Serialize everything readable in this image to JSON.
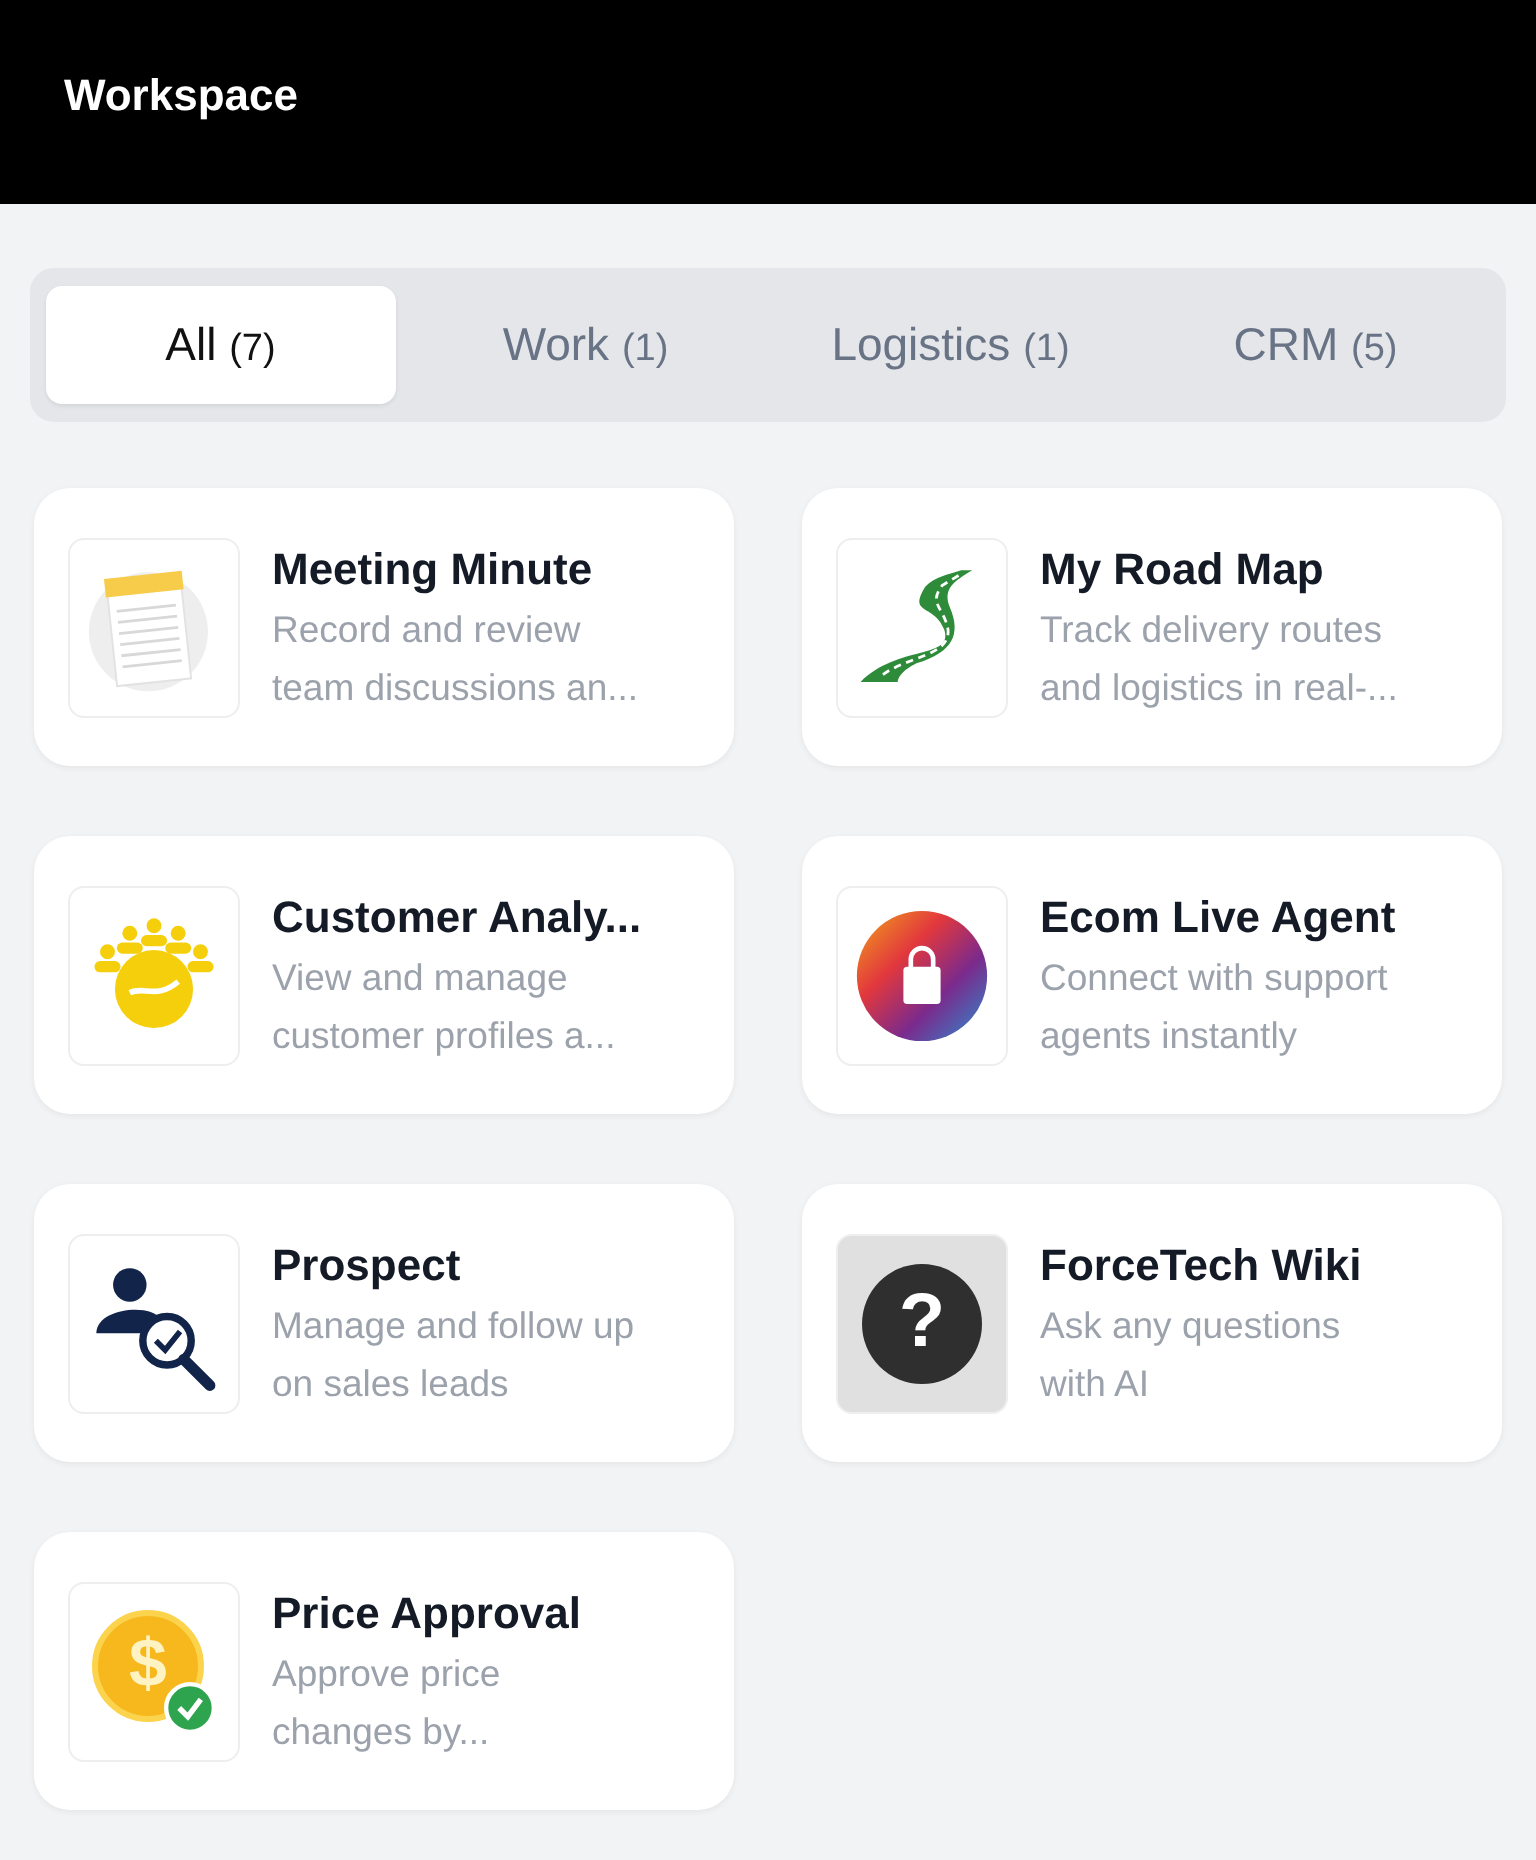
{
  "header": {
    "title": "Workspace"
  },
  "tabs": [
    {
      "label": "All",
      "count": "(7)",
      "selected": true
    },
    {
      "label": "Work",
      "count": "(1)",
      "selected": false
    },
    {
      "label": "Logistics",
      "count": "(1)",
      "selected": false
    },
    {
      "label": "CRM",
      "count": "(5)",
      "selected": false
    }
  ],
  "apps": [
    {
      "title": "Meeting Minute",
      "description": [
        "Record and review",
        "team discussions an..."
      ],
      "icon": {
        "kind": "notepad"
      }
    },
    {
      "title": "My Road Map",
      "description": [
        "Track delivery routes",
        "and logistics in real-..."
      ],
      "icon": {
        "kind": "road"
      }
    },
    {
      "title": "Customer Analy...",
      "description": [
        "View and manage",
        "customer profiles a..."
      ],
      "icon": {
        "kind": "people"
      }
    },
    {
      "title": "Ecom Live Agent",
      "description": [
        "Connect with support",
        "agents instantly"
      ],
      "icon": {
        "kind": "bag"
      }
    },
    {
      "title": "Prospect",
      "description": [
        "Manage and follow up",
        "on sales leads"
      ],
      "icon": {
        "kind": "prospect"
      }
    },
    {
      "title": "ForceTech Wiki",
      "description": [
        "Ask any questions",
        "with AI"
      ],
      "icon": {
        "kind": "question",
        "glyph": "?"
      }
    },
    {
      "title": "Price Approval",
      "description": [
        "Approve price",
        "changes by..."
      ],
      "icon": {
        "kind": "coin",
        "glyph": "$"
      }
    }
  ]
}
